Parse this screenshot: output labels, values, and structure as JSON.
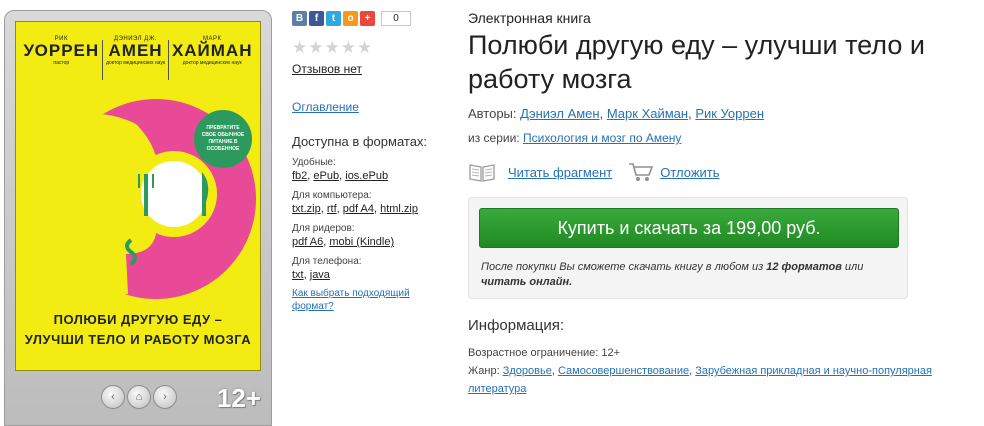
{
  "colors": {
    "link": "#2671b5",
    "buy": "#2a9c2d",
    "cover": "#f3ec12",
    "badge": "#2c9a5e"
  },
  "cover": {
    "authors": [
      {
        "first": "РИК",
        "last": "УОРРЕН",
        "role": "пастор"
      },
      {
        "first": "ДЭНИЭЛ ДЖ.",
        "last": "АМЕН",
        "role": "доктор медицинских наук"
      },
      {
        "first": "МАРК",
        "last": "ХАЙМАН",
        "role": "доктор медицинских наук"
      }
    ],
    "badge": "ПРЕВРАТИТЕ СВОЕ ОБЫЧНОЕ ПИТАНИЕ В ОСОБЕННОЕ",
    "title_line1": "ПОЛЮБИ ДРУГУЮ ЕДУ –",
    "title_line2": "УЛУЧШИ ТЕЛО И РАБОТУ МОЗГА",
    "age": "12+"
  },
  "share": {
    "buttons": [
      {
        "icon": "vk-icon",
        "glyph": "В",
        "color": "#5b7fa6"
      },
      {
        "icon": "facebook-icon",
        "glyph": "f",
        "color": "#3b5998"
      },
      {
        "icon": "twitter-icon",
        "glyph": "t",
        "color": "#2fa9e0"
      },
      {
        "icon": "odnoklassniki-icon",
        "glyph": "о",
        "color": "#f59a1c"
      },
      {
        "icon": "plus-icon",
        "glyph": "+",
        "color": "#e9483b"
      }
    ],
    "count": "0"
  },
  "rating": {
    "stars": "★★★★★",
    "reviews": "Отзывов нет"
  },
  "toc_link": "Оглавление",
  "formats": {
    "title": "Доступна в форматах:",
    "groups": [
      {
        "label": "Удобные:",
        "items": [
          "fb2",
          "ePub",
          "ios.ePub"
        ]
      },
      {
        "label": "Для компьютера:",
        "items": [
          "txt.zip",
          "rtf",
          "pdf A4",
          "html.zip"
        ]
      },
      {
        "label": "Для ридеров:",
        "items": [
          "pdf A6",
          "mobi (Kindle)"
        ]
      },
      {
        "label": "Для телефона:",
        "items": [
          "txt",
          "java"
        ]
      }
    ],
    "help": "Как выбрать подходящий формат?"
  },
  "book": {
    "type": "Электронная книга",
    "title": "Полюби другую еду – улучши тело и работу мозга",
    "authors_label": "Авторы:",
    "authors": [
      "Дэниэл Амен",
      "Марк Хайман",
      "Рик Уоррен"
    ],
    "series_label": "из серии:",
    "series": "Психология и мозг по Амену",
    "read_fragment": "Читать фрагмент",
    "postpone": "Отложить",
    "buy": "Купить и скачать за 199,00 руб.",
    "note_1": "После покупки Вы сможете скачать книгу в любом из ",
    "note_bold1": "12 форматов",
    "note_2": " или ",
    "note_bold2": "читать онлайн.",
    "info_title": "Информация:",
    "age_label": "Возрастное ограничение: 12+",
    "genre_label": "Жанр:",
    "genres": [
      "Здоровье",
      "Самосовершенствование",
      "Зарубежная прикладная и научно-популярная литература"
    ]
  }
}
